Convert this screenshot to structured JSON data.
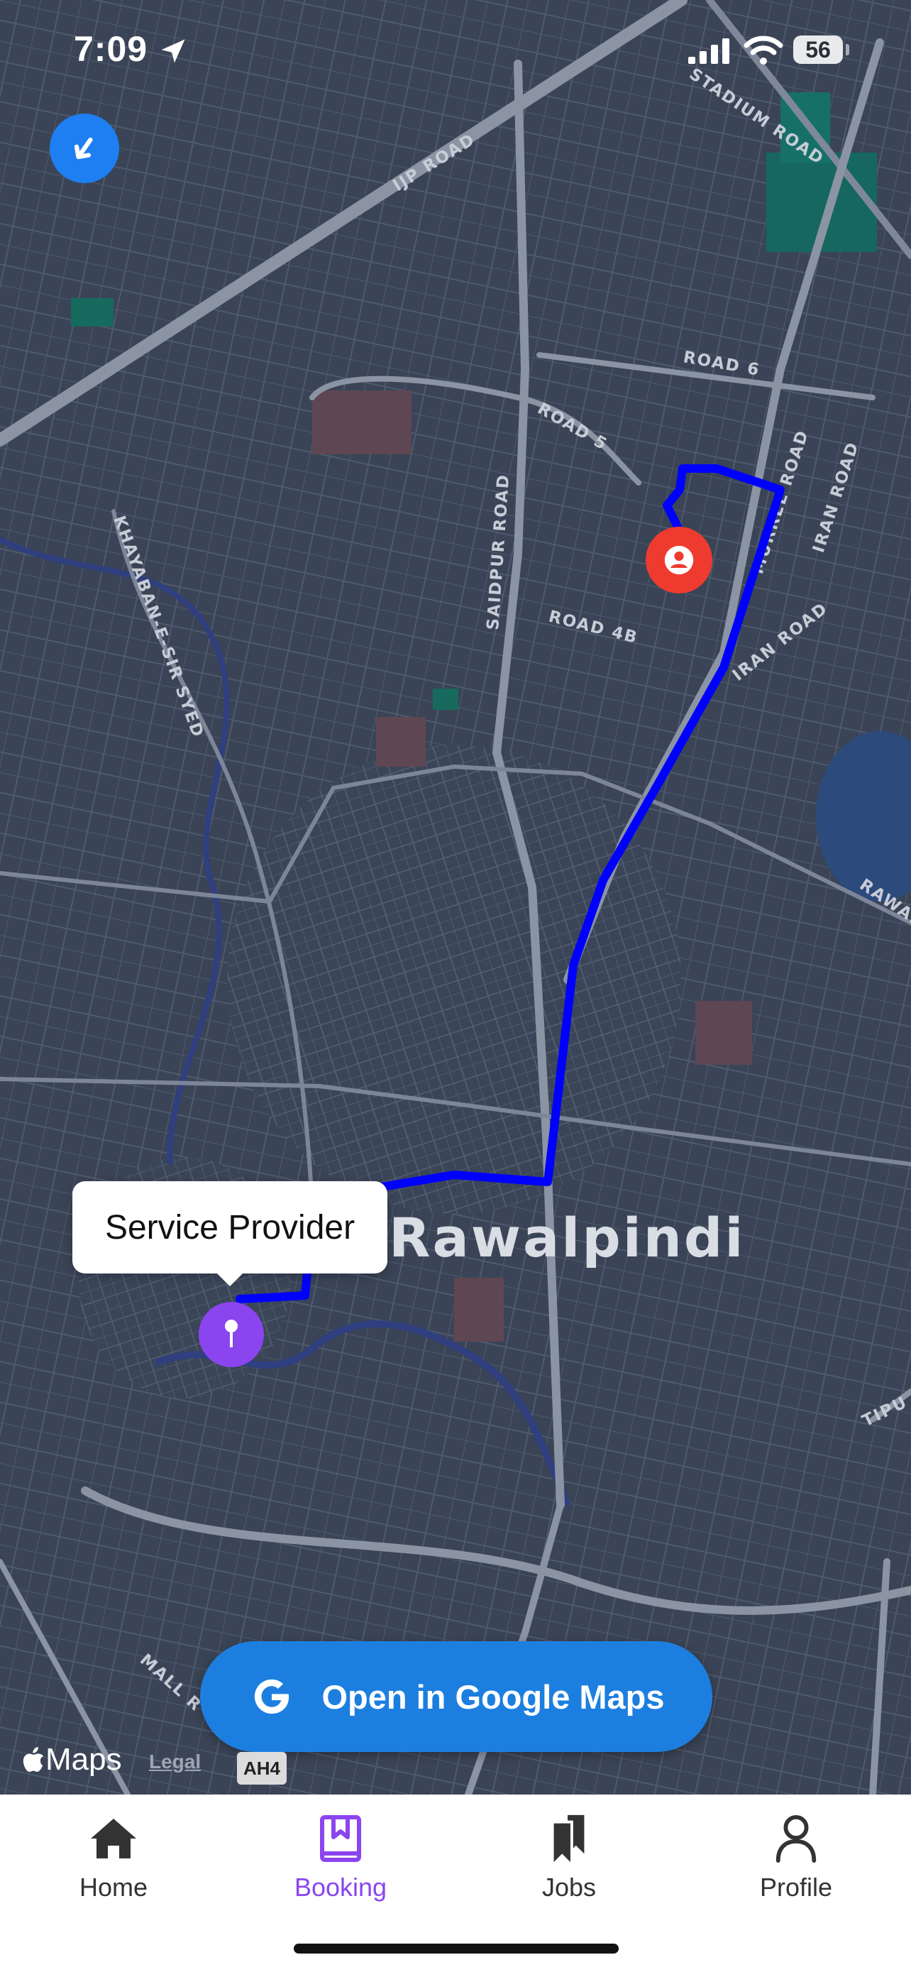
{
  "status_bar": {
    "time": "7:09",
    "battery": "56"
  },
  "map": {
    "city": "Rawalpindi",
    "road_labels": {
      "ijp_road": "IJP ROAD",
      "stadium_road": "STADIUM ROAD",
      "road_6": "ROAD 6",
      "road_5": "ROAD 5",
      "murree_road": "MURREE ROAD",
      "iran_road_1": "IRAN ROAD",
      "iran_road_2": "IRAN ROAD",
      "khayaban": "KHAYABAN-E-SIR SYED",
      "saidpur_road": "SAIDPUR ROAD",
      "road_4b": "ROAD 4B",
      "rawal": "RAWAL",
      "tipu": "TIPU",
      "mall": "MALL R"
    },
    "route_color": "#0000ff",
    "highway_badge": "AH4"
  },
  "tooltip": {
    "text": "Service Provider"
  },
  "pins": {
    "provider": {
      "color": "#8b45ef",
      "icon": "map-pin-icon"
    },
    "customer": {
      "color": "#ef3b2f",
      "icon": "person-icon"
    }
  },
  "buttons": {
    "open_maps": "Open in Google Maps",
    "back": {
      "icon": "back-arrow-icon",
      "color": "#1d7ff2"
    }
  },
  "attribution": {
    "maps": "Maps",
    "legal": "Legal"
  },
  "tabs": [
    {
      "label": "Home",
      "icon": "home-icon",
      "active": false
    },
    {
      "label": "Booking",
      "icon": "bookmark-icon",
      "active": true
    },
    {
      "label": "Jobs",
      "icon": "jobs-icon",
      "active": false
    },
    {
      "label": "Profile",
      "icon": "person-icon",
      "active": false
    }
  ],
  "colors": {
    "accent": "#8b45ef",
    "map_bg": "#3a4456",
    "button": "#1c7fe0"
  }
}
